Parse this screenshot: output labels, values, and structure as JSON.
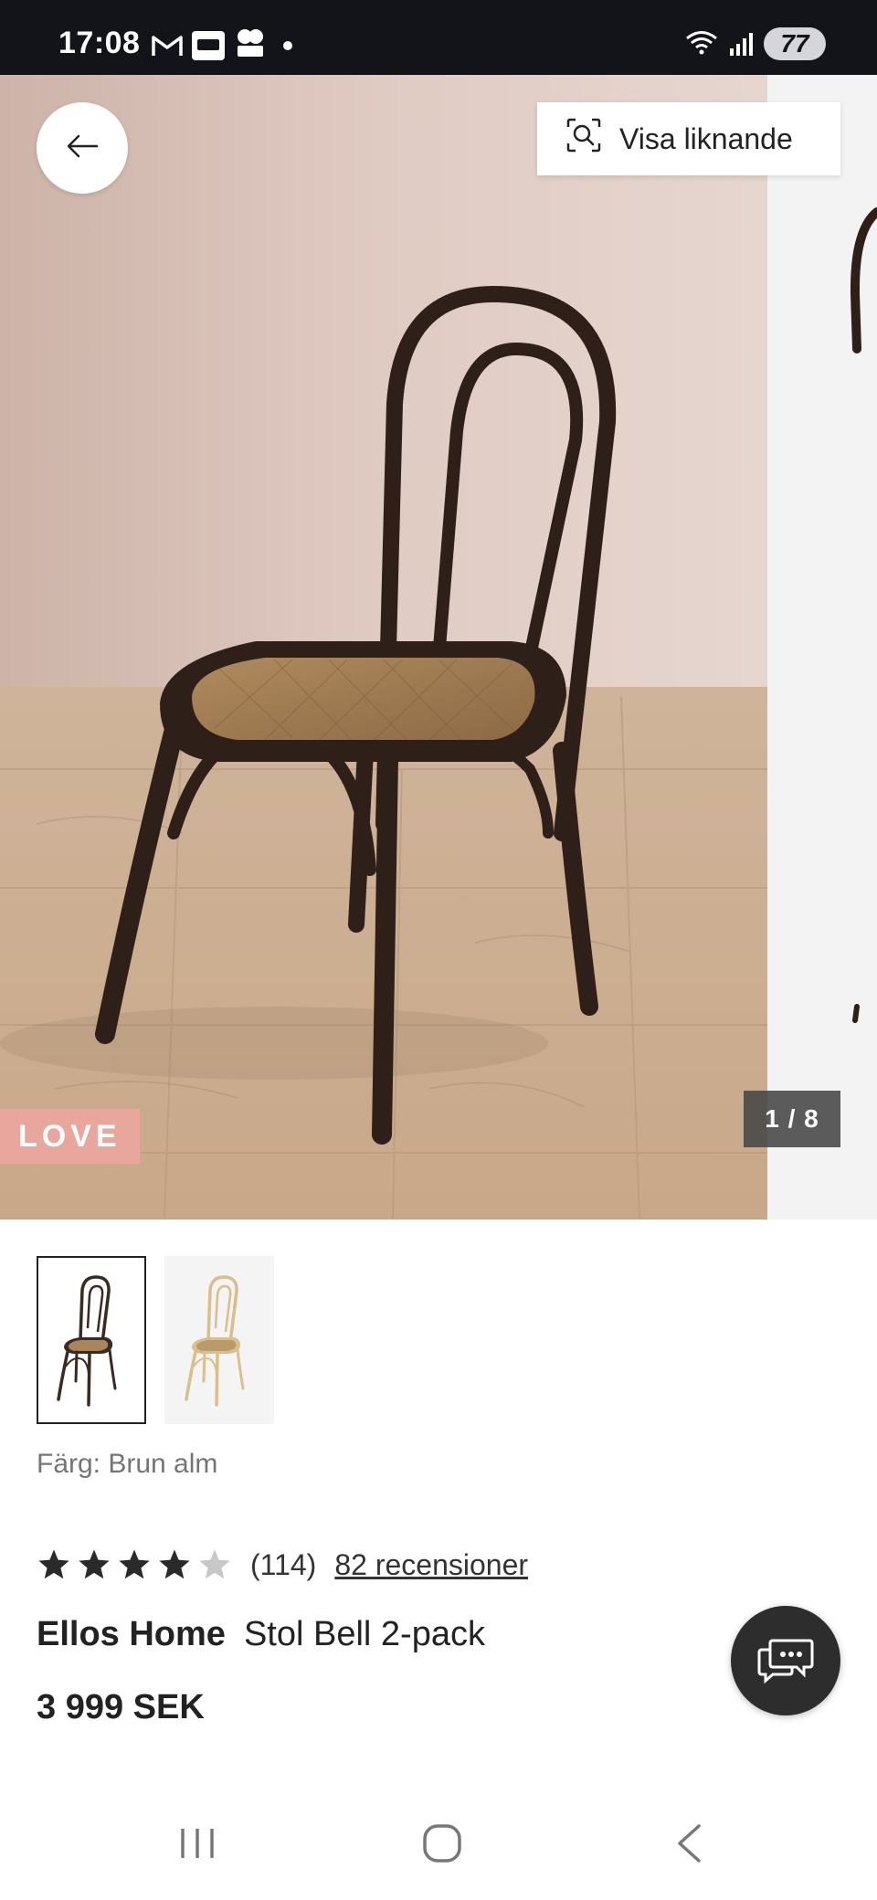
{
  "status_bar": {
    "time": "17:08",
    "battery": "77",
    "left_icons": [
      "gmail-icon",
      "mystore-app-icon",
      "sas-app-icon",
      "notification-dot"
    ],
    "right_icons": [
      "wifi-icon",
      "signal-icon",
      "battery-icon"
    ]
  },
  "hero": {
    "similar_button_label": "Visa liknande",
    "badge": "LOVE",
    "image_counter": "1 / 8",
    "current_image": 1,
    "total_images": 8
  },
  "product": {
    "color_label": "Färg: Brun alm",
    "variants": [
      {
        "name": "Brun alm",
        "selected": true,
        "frame_color": "#3a2a22"
      },
      {
        "name": "Natur",
        "selected": false,
        "frame_color": "#d8bf8c"
      }
    ],
    "rating": 4,
    "rating_max": 5,
    "rating_count": "(114)",
    "reviews_link": "82 recensioner",
    "brand": "Ellos Home",
    "name": "Stol Bell 2-pack",
    "price": "3 999 SEK"
  },
  "colors": {
    "badge_bg": "#e8a69d",
    "star_filled": "#2a2a2a",
    "star_empty": "#c8c8c8",
    "fab_bg": "#2d2d2d",
    "status_bar_bg": "#13131a"
  },
  "nav": {
    "buttons": [
      "recent-apps",
      "home",
      "back"
    ]
  }
}
